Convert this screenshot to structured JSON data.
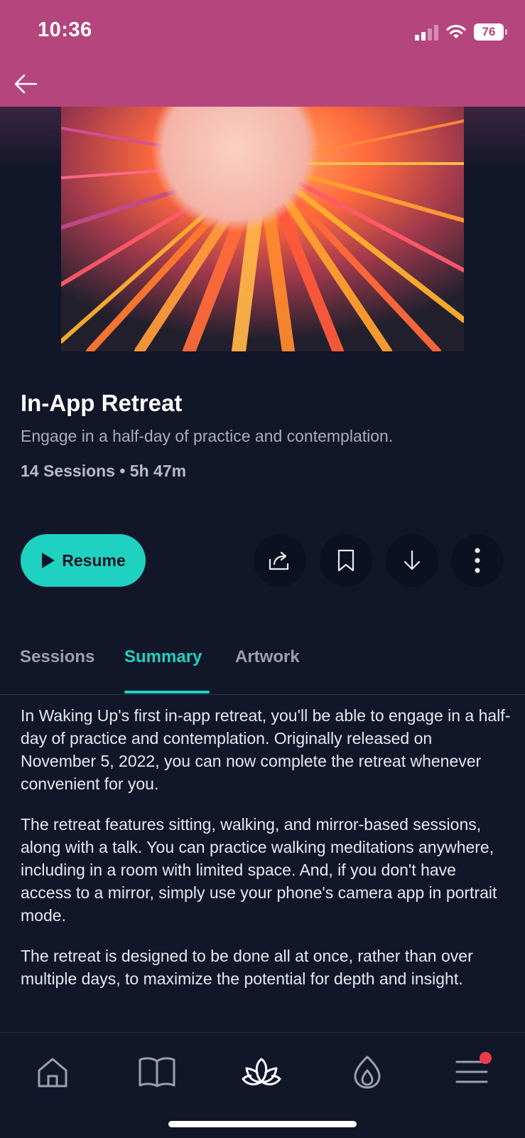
{
  "status_bar": {
    "time": "10:36",
    "battery": "76"
  },
  "header": {
    "back_label": "Back"
  },
  "retreat": {
    "title": "In-App Retreat",
    "subtitle": "Engage in a half-day of practice and contemplation.",
    "meta": "14 Sessions • 5h 47m"
  },
  "actions": {
    "resume_label": "Resume",
    "icons": [
      "share-icon",
      "bookmark-icon",
      "download-icon",
      "more-vertical-icon"
    ]
  },
  "tabs": [
    {
      "label": "Sessions",
      "active": false
    },
    {
      "label": "Summary",
      "active": true
    },
    {
      "label": "Artwork",
      "active": false
    }
  ],
  "summary": {
    "paragraphs": [
      "In Waking Up's first in-app retreat, you'll be able to engage in a half-day of practice and contemplation. Originally released on November 5, 2022, you can now complete the retreat whenever convenient for you.",
      "The retreat features sitting, walking, and mirror-based sessions, along with a talk. You can practice walking meditations anywhere, including in a room with limited space. And, if you don't have access to a mirror, simply use your phone's camera app in portrait mode.",
      "The retreat is designed to be done all at once, rather than over multiple days, to maximize the potential for depth and insight."
    ]
  },
  "bottom_nav": {
    "items": [
      "home-icon",
      "library-icon",
      "meditate-lotus-icon",
      "practice-flame-icon",
      "menu-icon"
    ],
    "active": "meditate-lotus-icon",
    "menu_has_notification": true
  },
  "colors": {
    "status_bar_bg": "#b5457d",
    "page_bg": "#121629",
    "accent": "#1fd1c1",
    "notification": "#ee3b4b"
  }
}
